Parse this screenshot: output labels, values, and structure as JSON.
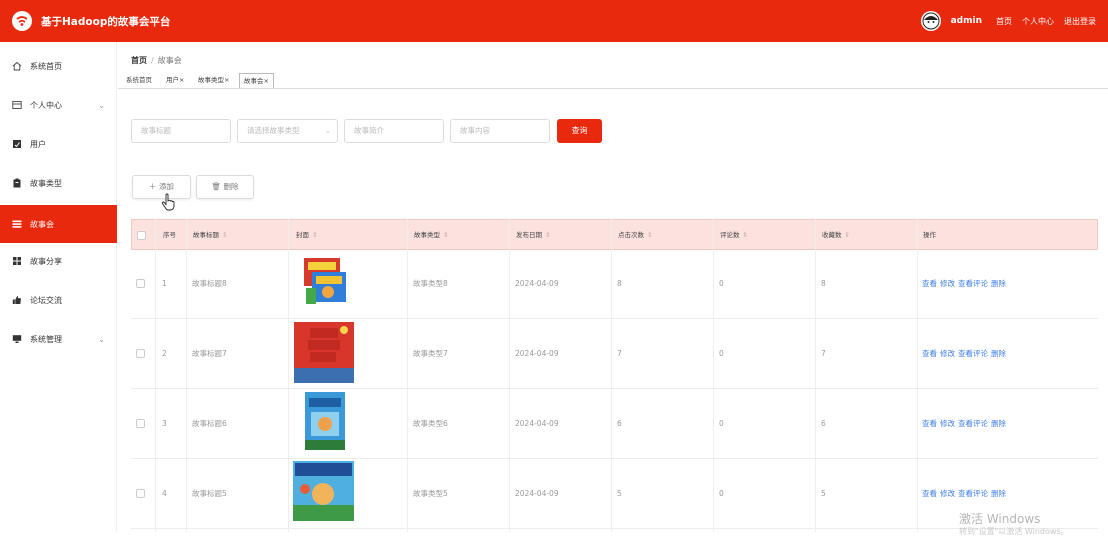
{
  "app": {
    "title": "基于Hadoop的故事会平台"
  },
  "header": {
    "user": "admin",
    "links": [
      "首页",
      "个人中心",
      "退出登录"
    ]
  },
  "sidebar": {
    "items": [
      {
        "label": "系统首页",
        "icon": "home-icon",
        "active": false,
        "expandable": false
      },
      {
        "label": "个人中心",
        "icon": "id-card-icon",
        "active": false,
        "expandable": true
      },
      {
        "label": "用户",
        "icon": "user-list-icon",
        "active": false,
        "expandable": false
      },
      {
        "label": "故事类型",
        "icon": "clipboard-icon",
        "active": false,
        "expandable": false
      },
      {
        "label": "故事会",
        "icon": "list-icon",
        "active": true,
        "expandable": false
      },
      {
        "label": "故事分享",
        "icon": "grid-icon",
        "active": false,
        "expandable": false
      },
      {
        "label": "论坛交流",
        "icon": "thumbs-up-icon",
        "active": false,
        "expandable": false
      },
      {
        "label": "系统管理",
        "icon": "monitor-icon",
        "active": false,
        "expandable": true
      }
    ]
  },
  "breadcrumb": {
    "home": "首页",
    "sep": "/",
    "current": "故事会"
  },
  "tabs": [
    {
      "label": "系统首页",
      "closable": false,
      "active": false
    },
    {
      "label": "用户",
      "closable": true,
      "active": false
    },
    {
      "label": "故事类型",
      "closable": true,
      "active": false
    },
    {
      "label": "故事会",
      "closable": true,
      "active": true
    }
  ],
  "search": {
    "title_placeholder": "故事标题",
    "type_placeholder": "请选择故事类型",
    "intro_placeholder": "故事简介",
    "content_placeholder": "故事内容",
    "query_label": "查询"
  },
  "toolbar": {
    "add_label": "添加",
    "delete_label": "删除"
  },
  "table": {
    "columns": [
      "序号",
      "故事标题",
      "封面",
      "故事类型",
      "发布日期",
      "点击次数",
      "评论数",
      "收藏数",
      "操作"
    ],
    "rows": [
      {
        "no": "1",
        "title": "故事标题8",
        "type": "故事类型8",
        "date": "2024-04-09",
        "clicks": "8",
        "comments": "0",
        "favorites": "8"
      },
      {
        "no": "2",
        "title": "故事标题7",
        "type": "故事类型7",
        "date": "2024-04-09",
        "clicks": "7",
        "comments": "0",
        "favorites": "7"
      },
      {
        "no": "3",
        "title": "故事标题6",
        "type": "故事类型6",
        "date": "2024-04-09",
        "clicks": "6",
        "comments": "0",
        "favorites": "6"
      },
      {
        "no": "4",
        "title": "故事标题5",
        "type": "故事类型5",
        "date": "2024-04-09",
        "clicks": "5",
        "comments": "0",
        "favorites": "5"
      }
    ],
    "actions": [
      "查看",
      "修改",
      "查看评论",
      "删除"
    ]
  },
  "watermark": {
    "line1": "激活 Windows",
    "line2": "转到\"设置\"以激活 Windows。"
  },
  "colors": {
    "brand": "#e8290e",
    "link": "#3f7ee8",
    "header_row": "#fbe2df"
  }
}
